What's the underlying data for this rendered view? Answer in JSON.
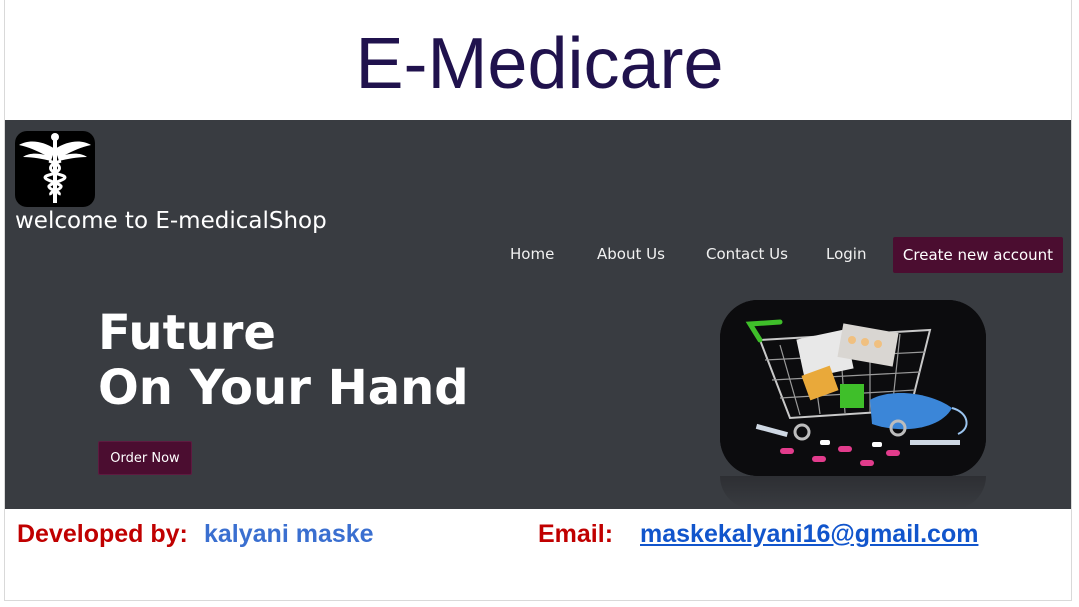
{
  "slide": {
    "title": "E-Medicare"
  },
  "site": {
    "welcome": "welcome to E-medicalShop",
    "nav": {
      "home": "Home",
      "about": "About Us",
      "contact": "Contact Us",
      "login": "Login",
      "create_account": "Create new account"
    },
    "hero": {
      "line1": "Future",
      "line2": "On Your Hand",
      "order_button": "Order Now"
    },
    "colors": {
      "background": "#393c41",
      "button": "#4b0d30",
      "title": "#20124d"
    },
    "icons": {
      "logo": "caduceus-icon",
      "hero": "shopping-cart-with-medicines-icon"
    }
  },
  "footer": {
    "developed_label": "Developed by:",
    "developer_name": "kalyani maske",
    "email_label": "Email:",
    "email": "maskekalyani16@gmail.com"
  }
}
